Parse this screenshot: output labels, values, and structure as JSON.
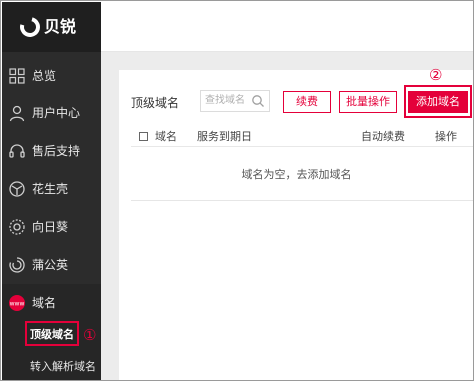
{
  "brand": {
    "name": "贝锐"
  },
  "sidebar": {
    "items": [
      {
        "label": "总览",
        "icon": "grid-icon"
      },
      {
        "label": "用户中心",
        "icon": "user-icon"
      },
      {
        "label": "售后支持",
        "icon": "headset-icon"
      },
      {
        "label": "花生壳",
        "icon": "cube-icon"
      },
      {
        "label": "向日葵",
        "icon": "sunflower-icon"
      },
      {
        "label": "蒲公英",
        "icon": "dandelion-icon"
      },
      {
        "label": "域名",
        "icon": "www-icon"
      }
    ],
    "sub_items": [
      {
        "label": "顶级域名"
      },
      {
        "label": "转入解析域名"
      }
    ]
  },
  "markers": {
    "step1": "①",
    "step2": "②"
  },
  "main": {
    "title": "顶级域名",
    "search": {
      "placeholder": "查找域名"
    },
    "buttons": {
      "renew": "续费",
      "batch": "批量操作",
      "add": "添加域名"
    },
    "table": {
      "columns": [
        "域名",
        "服务到期日",
        "自动续费",
        "操作"
      ],
      "empty_text": "域名为空，去添加域名"
    }
  },
  "colors": {
    "accent": "#e4003a",
    "sidebar_bg": "#2c2c2c"
  }
}
